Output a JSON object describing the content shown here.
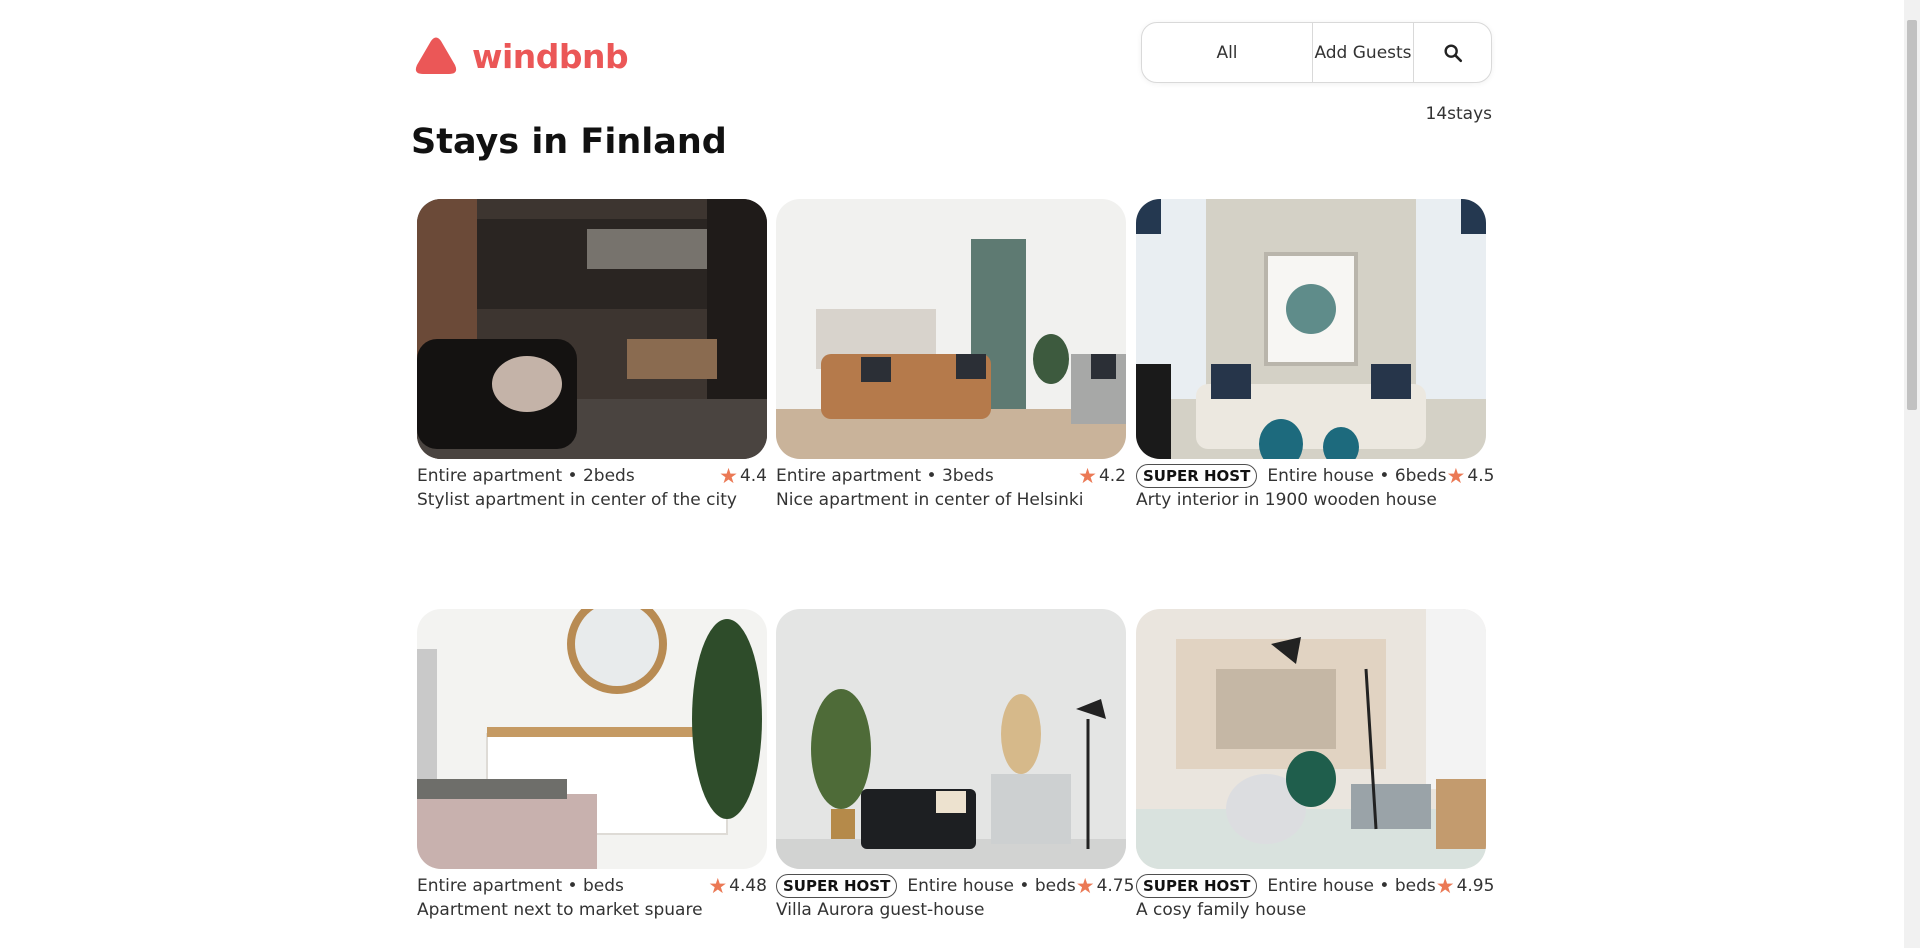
{
  "brand": {
    "name": "windbnb",
    "color": "#eb5757"
  },
  "search": {
    "location": "All",
    "guests": "Add Guests",
    "icon": "search-icon"
  },
  "stays_count": "14stays",
  "page_title": "Stays in Finland",
  "colors": {
    "accent": "#eb5757",
    "star": "#eb7955"
  },
  "stays": [
    {
      "super_host": false,
      "type": "Entire apartment • 2beds",
      "rating": "4.4",
      "title": "Stylist apartment in center of the city"
    },
    {
      "super_host": false,
      "type": "Entire apartment • 3beds",
      "rating": "4.2",
      "title": "Nice apartment in center of Helsinki"
    },
    {
      "super_host": true,
      "badge": "SUPER HOST",
      "type": "Entire house • 6beds",
      "rating": "4.5",
      "title": "Arty interior in 1900 wooden house"
    },
    {
      "super_host": false,
      "type": "Entire apartment • beds",
      "rating": "4.48",
      "title": "Apartment next to market spuare"
    },
    {
      "super_host": true,
      "badge": "SUPER HOST",
      "type": "Entire house • beds",
      "rating": "4.75",
      "title": "Villa Aurora guest-house"
    },
    {
      "super_host": true,
      "badge": "SUPER HOST",
      "type": "Entire house • beds",
      "rating": "4.95",
      "title": "A cosy family house"
    }
  ]
}
